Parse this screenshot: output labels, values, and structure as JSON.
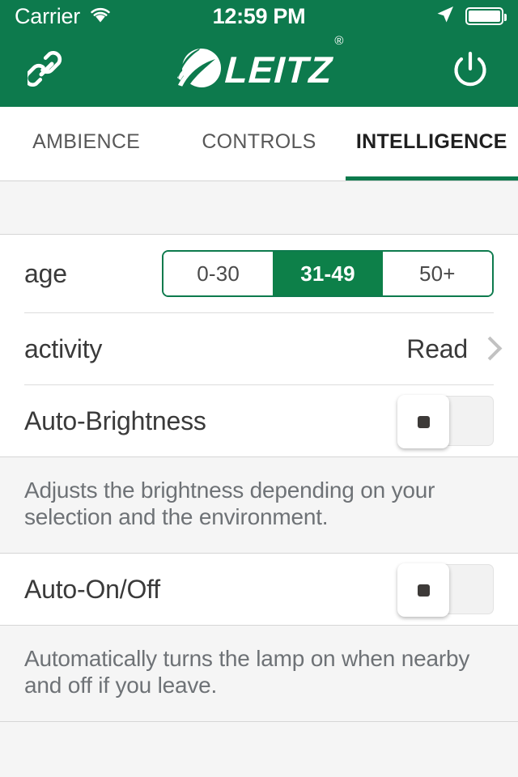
{
  "status_bar": {
    "carrier": "Carrier",
    "time": "12:59 PM",
    "wifi_icon": "wifi-icon",
    "location_icon": "location-arrow-icon",
    "battery_icon": "battery-full-icon"
  },
  "header": {
    "link_icon": "chain-link-icon",
    "power_icon": "power-icon",
    "brand_name": "LEITZ",
    "brand_mark": "leaf-logo-icon",
    "registered_mark": "®",
    "background_color": "#0d7a4d"
  },
  "tabs": [
    {
      "label": "AMBIENCE",
      "active": false
    },
    {
      "label": "CONTROLS",
      "active": false
    },
    {
      "label": "INTELLIGENCE",
      "active": true
    }
  ],
  "settings": {
    "age": {
      "label": "age",
      "options": [
        "0-30",
        "31-49",
        "50+"
      ],
      "selected_index": 1,
      "selected_value": "31-49",
      "accent_color": "#0d8049"
    },
    "activity": {
      "label": "activity",
      "value": "Read",
      "chevron_icon": "chevron-right-icon"
    },
    "auto_brightness": {
      "label": "Auto-Brightness",
      "state": "off",
      "description": "Adjusts the brightness depending on your selection and the environment."
    },
    "auto_on_off": {
      "label": "Auto-On/Off",
      "state": "off",
      "description": "Automatically turns the lamp on when nearby and off if you leave."
    }
  }
}
